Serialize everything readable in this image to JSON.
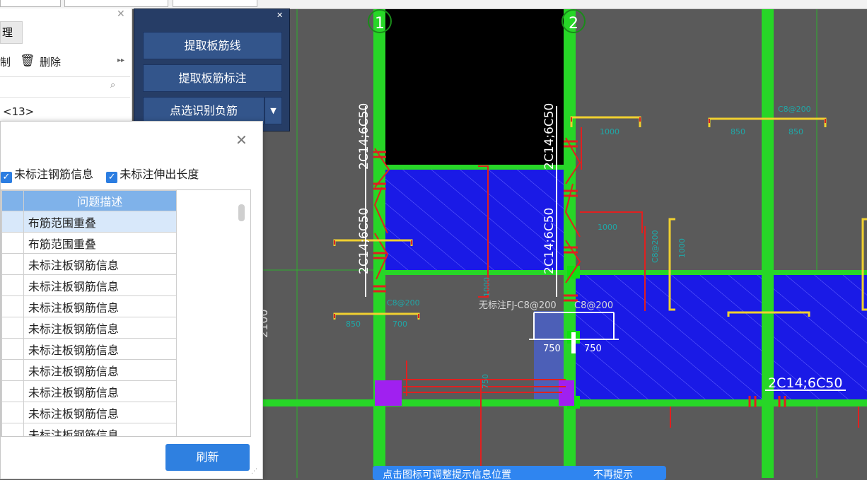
{
  "left_panel": {
    "tab_label": "理",
    "copy_label": "制",
    "delete_label": "删除",
    "layer_label": "<13>"
  },
  "command_panel": {
    "buttons": [
      "提取板筋线",
      "提取板筋标注",
      "点选识别负筋"
    ]
  },
  "dialog": {
    "check1_label": "未标注钢筋信息",
    "check2_label": "未标注伸出长度",
    "column_header": "问题描述",
    "rows": [
      "布筋范围重叠",
      "布筋范围重叠",
      "未标注板钢筋信息",
      "未标注板钢筋信息",
      "未标注板钢筋信息",
      "未标注板钢筋信息",
      "未标注板钢筋信息",
      "未标注板钢筋信息",
      "未标注板钢筋信息",
      "未标注板钢筋信息",
      "未标注板钢筋信息"
    ],
    "selected_row": 0,
    "refresh_label": "刷新"
  },
  "cad": {
    "axis_labels": [
      "1",
      "2"
    ],
    "beam_labels": [
      "2C14;6C50",
      "2C14;6C50",
      "2C14;6C50",
      "2C14;6C50",
      "2C14;6C50"
    ],
    "annotation": "无标注FJ-C8@200",
    "annotation2": "C8@200",
    "dims": [
      "750",
      "750"
    ],
    "dim_2100": "2100",
    "small_labels": [
      "1000",
      "C8@200",
      "850",
      "850",
      "1000",
      "C8@200",
      "850",
      "700",
      "C8@200",
      "1000",
      "1000",
      "750"
    ]
  },
  "tooltip": {
    "text": "点击图标可调整提示信息位置",
    "action": "不再提示"
  },
  "colors": {
    "canvas": "#5a5a5a",
    "slab_blue": "#1a1ae6",
    "beam_green": "#27d627",
    "rebar_red": "#e02020",
    "dim_yellow": "#f0d030",
    "teal": "#1fa8a8",
    "accent": "#2f80e0",
    "panel_dark": "#263d66"
  }
}
